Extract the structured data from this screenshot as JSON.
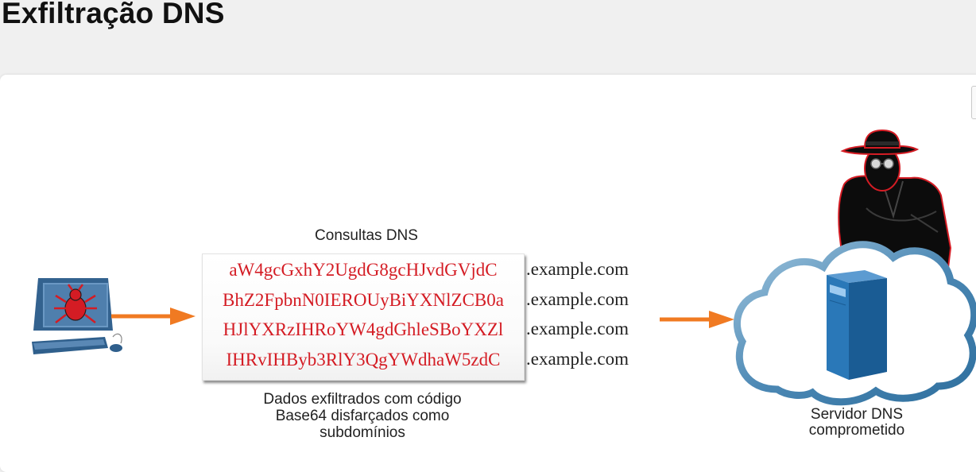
{
  "title": "Exfiltração DNS",
  "diagram": {
    "queries_title": "Consultas DNS",
    "queries": [
      "aW4gcGxhY2UgdG8gcHJvdGVjdC",
      "BhZ2FpbnN0IEROUyBiYXNlZCB0a",
      "HJlYXRzIHRoYW4gdGhleSBoYXZl",
      "IHRvIHByb3RlY3QgYWdhaW5zdC"
    ],
    "domain_suffix": ".example.com",
    "caption_lines": [
      "Dados exfiltrados com código",
      "Base64 disfarçados como",
      "subdomínios"
    ],
    "server_label_lines": [
      "Servidor DNS",
      "comprometido"
    ]
  },
  "colors": {
    "query_text": "#d41c24",
    "arrow": "#f07a22",
    "cloud": "#5b97bf",
    "server": "#1f6ea5",
    "monitor_screen": "#4f7fad",
    "bug": "#d41c24"
  }
}
